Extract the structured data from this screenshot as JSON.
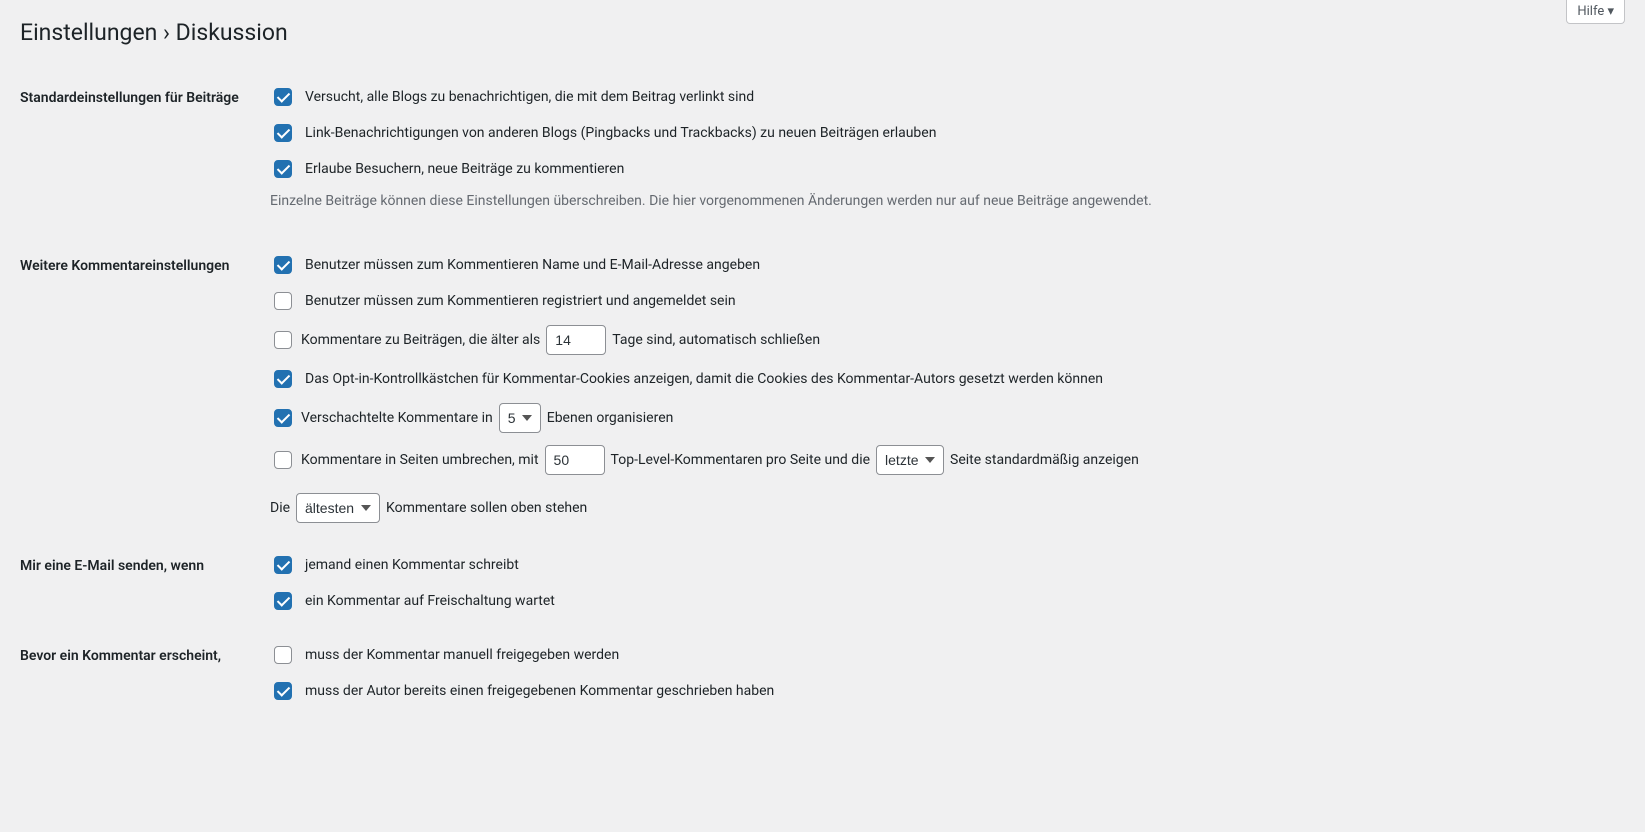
{
  "help_tab": "Hilfe",
  "page_title": "Einstellungen › Diskussion",
  "sections": {
    "defaults": {
      "heading": "Standardeinstellungen für Beiträge",
      "opt_pingback": "Versucht, alle Blogs zu benachrichtigen, die mit dem Beitrag verlinkt sind",
      "opt_ping_status": "Link-Benachrichtigungen von anderen Blogs (Pingbacks und Trackbacks) zu neuen Beiträgen erlauben",
      "opt_comment_status": "Erlaube Besuchern, neue Beiträge zu kommentieren",
      "description": "Einzelne Beiträge können diese Einstellungen überschreiben. Die hier vorgenommenen Änderungen werden nur auf neue Beiträge angewendet."
    },
    "other": {
      "heading": "Weitere Kommentareinstellungen",
      "opt_name_email": "Benutzer müssen zum Kommentieren Name und E-Mail-Adresse angeben",
      "opt_registration": "Benutzer müssen zum Kommentieren registriert und angemeldet sein",
      "opt_close_before": "Kommentare zu Beiträgen, die älter als",
      "opt_close_days": "14",
      "opt_close_after": "Tage sind, automatisch schließen",
      "opt_cookies": "Das Opt-in-Kontrollkästchen für Kommentar-Cookies anzeigen, damit die Cookies des Kommentar-Autors gesetzt werden können",
      "opt_thread_before": "Verschachtelte Kommentare in",
      "opt_thread_depth": "5",
      "opt_thread_after": "Ebenen organisieren",
      "opt_page_before": "Kommentare in Seiten umbrechen, mit",
      "opt_page_perpage": "50",
      "opt_page_mid": "Top-Level-Kommentaren pro Seite und die",
      "opt_page_default": "letzte",
      "opt_page_after": "Seite standardmäßig anzeigen",
      "opt_order_before": "Die",
      "opt_order_value": "ältesten",
      "opt_order_after": "Kommentare sollen oben stehen"
    },
    "email": {
      "heading": "Mir eine E-Mail senden, wenn",
      "opt_new_comment": "jemand einen Kommentar schreibt",
      "opt_moderation": "ein Kommentar auf Freischaltung wartet"
    },
    "before": {
      "heading": "Bevor ein Kommentar erscheint,",
      "opt_manual": "muss der Kommentar manuell freigegeben werden",
      "opt_previous": "muss der Autor bereits einen freigegebenen Kommentar geschrieben haben"
    }
  }
}
